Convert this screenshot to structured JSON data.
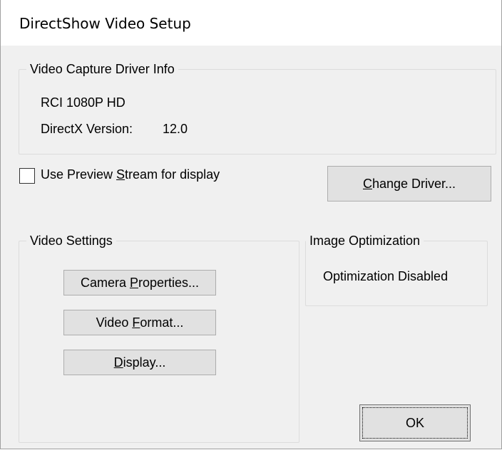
{
  "window": {
    "title": "DirectShow Video Setup"
  },
  "driver_info": {
    "legend": "Video Capture Driver Info",
    "device_name": "RCI 1080P HD",
    "directx_label": "DirectX Version:",
    "directx_value": "12.0"
  },
  "preview": {
    "checkbox_label_pre": "Use Preview ",
    "checkbox_label_accel": "S",
    "checkbox_label_post": "tream for display",
    "checked": false
  },
  "change_driver": {
    "accel": "C",
    "rest": "hange Driver..."
  },
  "video_settings": {
    "legend": "Video Settings",
    "camera_properties": {
      "pre": "Camera ",
      "accel": "P",
      "post": "roperties..."
    },
    "video_format": {
      "pre": "Video ",
      "accel": "F",
      "post": "ormat..."
    },
    "display": {
      "pre": "",
      "accel": "D",
      "post": "isplay..."
    }
  },
  "image_optimization": {
    "legend": "Image Optimization",
    "status": "Optimization Disabled"
  },
  "ok_button": {
    "label": "OK"
  }
}
